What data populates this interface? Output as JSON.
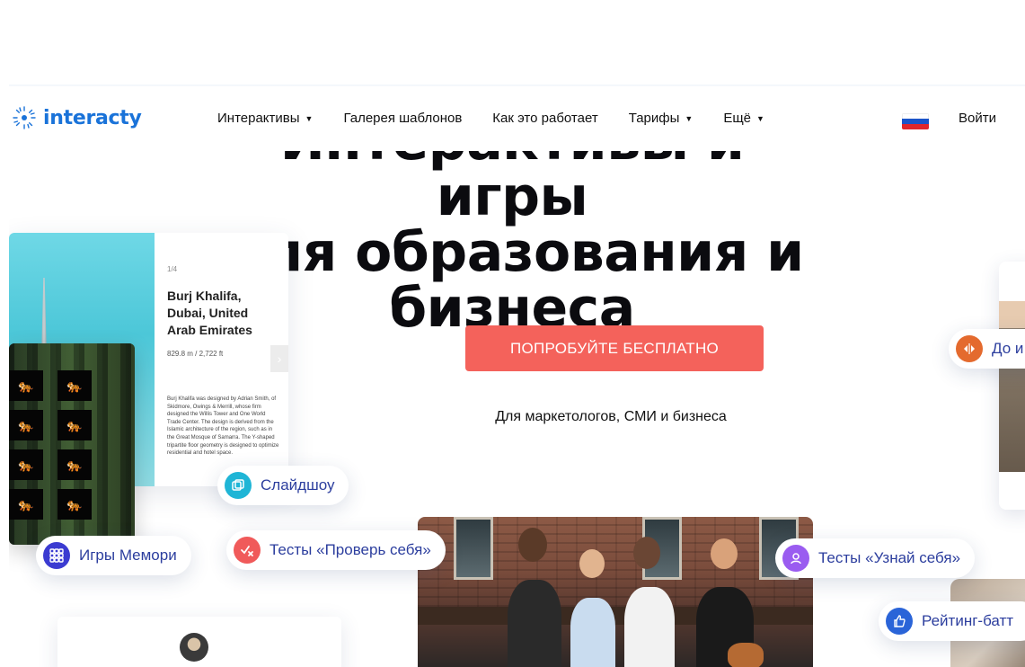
{
  "header": {
    "logo_text": "interacty",
    "nav": [
      {
        "label": "Интерактивы",
        "has_dropdown": true
      },
      {
        "label": "Галерея шаблонов",
        "has_dropdown": false
      },
      {
        "label": "Как это работает",
        "has_dropdown": false
      },
      {
        "label": "Тарифы",
        "has_dropdown": true
      },
      {
        "label": "Ещё",
        "has_dropdown": true
      }
    ],
    "language_flag": "ru-flag-icon",
    "login_label": "Войти"
  },
  "hero": {
    "title_line1": "Интерактивы и игры",
    "title_line2": "для образования и",
    "title_line3": "бизнеса",
    "cta_label": "ПОПРОБУЙТЕ БЕСПЛАТНО",
    "subtitle": "Для маркетологов, СМИ и бизнеса"
  },
  "burj_card": {
    "index": "1/4",
    "title": "Burj Khalifa, Dubai, United Arab Emirates",
    "meta": "829.8 m / 2,722 ft",
    "description": "Burj Khalifa was designed by Adrian Smith, of Skidmore, Owings & Merrill, whose firm designed the Willis Tower and One World Trade Center. The design is derived from the Islamic architecture of the region, such as in the Great Mosque of Samarra. The Y-shaped tripartite floor geometry is designed to optimize residential and hotel space."
  },
  "pills": {
    "slideshow": "Слайдшоу",
    "memory": "Игры Мемори",
    "quiz_check": "Тесты «Проверь себя»",
    "quiz_know": "Тесты «Узнай себя»",
    "before_after": "До и",
    "rating": "Рейтинг-батт"
  },
  "colors": {
    "accent": "#f4625b",
    "brand_blue": "#1a73d9",
    "pill_text": "#2c3e9e",
    "slideshow_icon": "#1fb5d6",
    "memory_icon": "#3b3bd1",
    "quiz_check_icon": "#f05a5a",
    "quiz_know_icon": "#9a5cf0",
    "before_after_icon": "#e46a2e",
    "rating_icon": "#2a64d8"
  }
}
